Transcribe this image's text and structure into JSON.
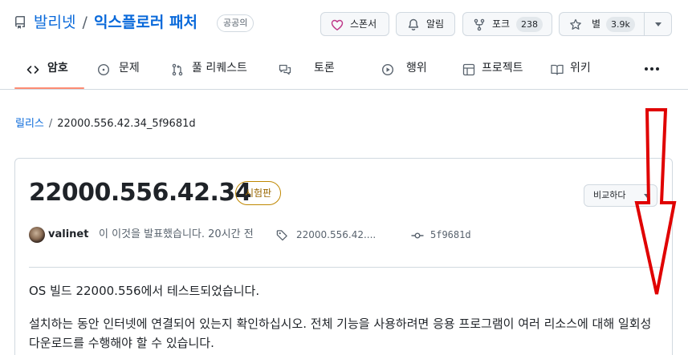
{
  "repo": {
    "owner": "발리넷",
    "separator": "/",
    "name": "익스플로러 패처",
    "visibility": "공공의"
  },
  "header_actions": {
    "sponsor_label": "스폰서",
    "watch_label": "알림",
    "fork_label": "포크",
    "fork_count": "238",
    "star_label": "별",
    "star_count": "3.9k"
  },
  "nav": {
    "tabs": [
      {
        "label": "암호",
        "icon": "code-icon",
        "active": true
      },
      {
        "label": "문제",
        "icon": "issue-icon"
      },
      {
        "label": "풀 리퀘스트",
        "icon": "pull-request-icon"
      },
      {
        "label": "토론",
        "icon": "discussion-icon"
      },
      {
        "label": "행위",
        "icon": "actions-icon"
      },
      {
        "label": "프로젝트",
        "icon": "table-icon"
      },
      {
        "label": "위키",
        "icon": "book-icon"
      }
    ],
    "more": "···"
  },
  "breadcrumb": {
    "link": "릴리스",
    "separator": "/",
    "current": "22000.556.42.34_5f9681d"
  },
  "release": {
    "title": "22000.556.42.34",
    "badge": "시험판",
    "compare_label": "비교하다",
    "author": "valinet",
    "published_text": "이 이것을 발표했습니다. 20시간 전",
    "tag": "22000.556.42....",
    "commit": "5f9681d",
    "body": [
      "OS 빌드 22000.556에서 테스트되었습니다.",
      "설치하는 동안 인터넷에 연결되어 있는지 확인하십시오. 전체 기능을 사용하려면 응용 프로그램이 여러 리소스에 대해 일회성 다운로드를 수행해야 할 수 있습니다."
    ]
  },
  "colors": {
    "link": "#0969da",
    "active_tab_underline": "#fd8c73",
    "prerelease": "#bf8700",
    "annotation_arrow": "#e00000",
    "sponsor_heart": "#bf3989"
  }
}
